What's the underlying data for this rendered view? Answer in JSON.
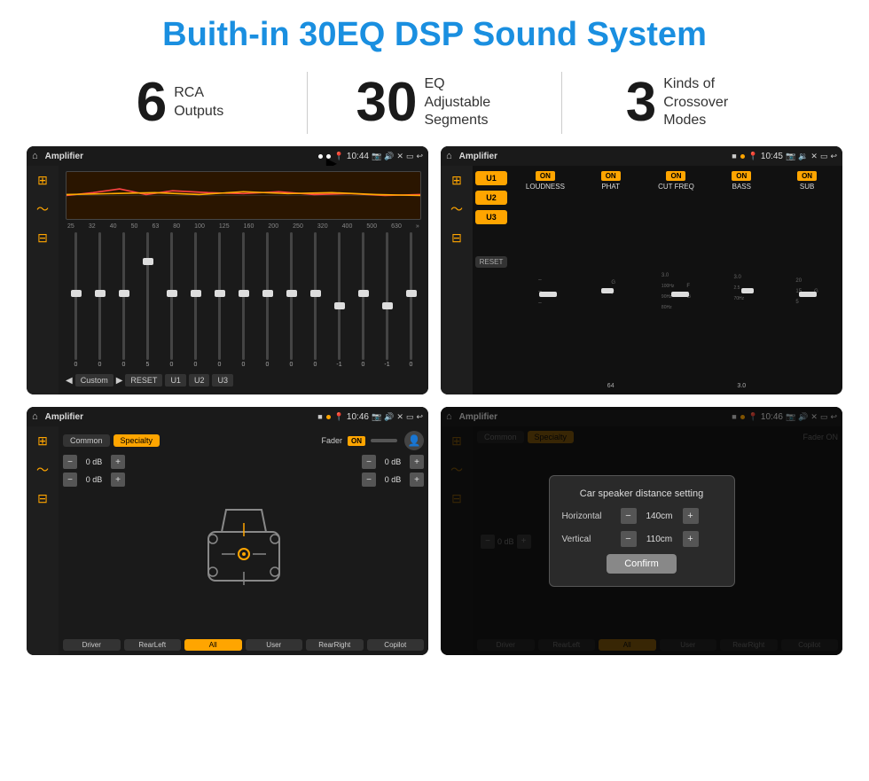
{
  "page": {
    "title": "Buith-in 30EQ DSP Sound System"
  },
  "stats": [
    {
      "number": "6",
      "label": "RCA\nOutputs"
    },
    {
      "number": "30",
      "label": "EQ Adjustable\nSegments"
    },
    {
      "number": "3",
      "label": "Kinds of\nCrossover Modes"
    }
  ],
  "screens": [
    {
      "id": "eq-screen",
      "time": "10:44",
      "app": "Amplifier",
      "eq_freqs": [
        "25",
        "32",
        "40",
        "50",
        "63",
        "80",
        "100",
        "125",
        "160",
        "200",
        "250",
        "320",
        "400",
        "500",
        "630"
      ],
      "eq_values": [
        "0",
        "0",
        "0",
        "5",
        "0",
        "0",
        "0",
        "0",
        "0",
        "0",
        "0",
        "-1",
        "0",
        "-1"
      ],
      "presets": [
        "Custom",
        "RESET",
        "U1",
        "U2",
        "U3"
      ]
    },
    {
      "id": "amp-screen",
      "time": "10:45",
      "app": "Amplifier",
      "presets": [
        "U1",
        "U2",
        "U3"
      ],
      "controls": [
        {
          "label": "LOUDNESS",
          "on": true
        },
        {
          "label": "PHAT",
          "on": true
        },
        {
          "label": "CUT FREQ",
          "on": true
        },
        {
          "label": "BASS",
          "on": true
        },
        {
          "label": "SUB",
          "on": true
        }
      ]
    },
    {
      "id": "crossover-screen",
      "time": "10:46",
      "app": "Amplifier",
      "tabs": [
        "Common",
        "Specialty"
      ],
      "fader_label": "Fader",
      "fader_on": "ON",
      "db_values": [
        "0 dB",
        "0 dB",
        "0 dB",
        "0 dB"
      ],
      "buttons": [
        "Driver",
        "RearLeft",
        "All",
        "User",
        "RearRight",
        "Copilot"
      ]
    },
    {
      "id": "dialog-screen",
      "time": "10:46",
      "app": "Amplifier",
      "dialog": {
        "title": "Car speaker distance setting",
        "horizontal_label": "Horizontal",
        "horizontal_value": "140cm",
        "vertical_label": "Vertical",
        "vertical_value": "110cm",
        "confirm_label": "Confirm"
      },
      "buttons": [
        "Driver",
        "RearLeft",
        "All",
        "User",
        "RearRight",
        "Copilot"
      ]
    }
  ]
}
